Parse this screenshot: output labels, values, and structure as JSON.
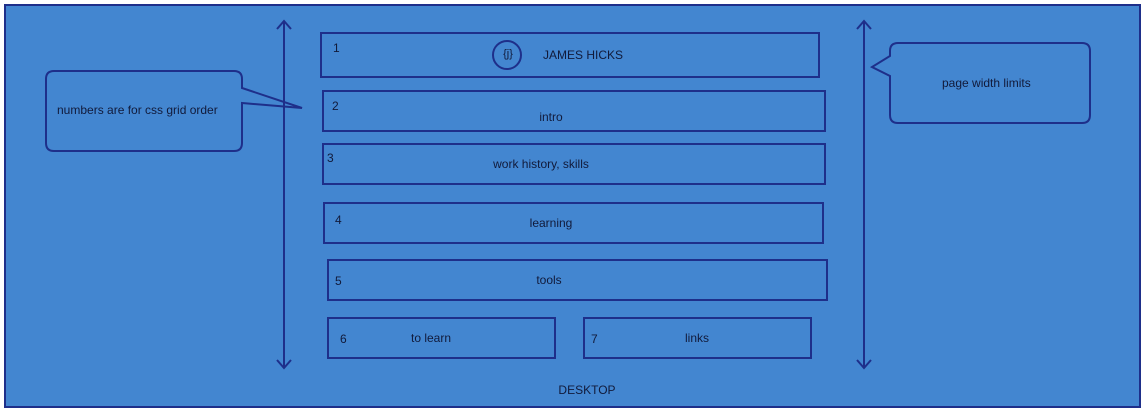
{
  "boxes": [
    {
      "num": "1",
      "label": "JAMES HICKS",
      "logo": "{j}"
    },
    {
      "num": "2",
      "label": "intro"
    },
    {
      "num": "3",
      "label": "work history, skills"
    },
    {
      "num": "4",
      "label": "learning"
    },
    {
      "num": "5",
      "label": "tools"
    },
    {
      "num": "6",
      "label": "to learn"
    },
    {
      "num": "7",
      "label": "links"
    }
  ],
  "callouts": {
    "left": "numbers are for css grid order",
    "right": "page width limits"
  },
  "footer": "DESKTOP",
  "colors": {
    "background": "#4386d0",
    "stroke": "#1e2f8a",
    "text": "#111a3a"
  }
}
